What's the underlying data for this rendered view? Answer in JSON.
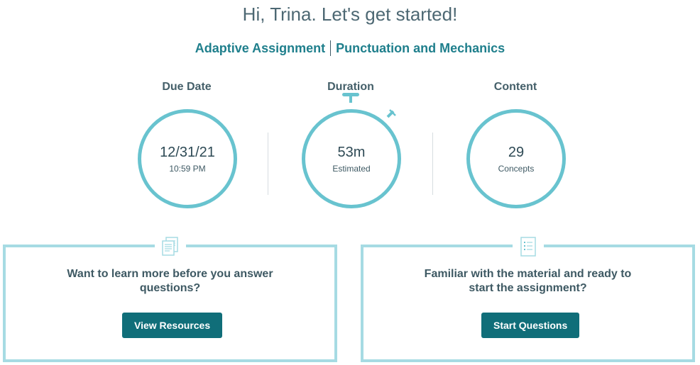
{
  "header": {
    "greeting": "Hi, Trina. Let's get started!",
    "assignment_type": "Adaptive Assignment",
    "assignment_name": "Punctuation and Mechanics"
  },
  "stats": {
    "due": {
      "label": "Due Date",
      "value": "12/31/21",
      "sub": "10:59 PM"
    },
    "duration": {
      "label": "Duration",
      "value": "53m",
      "sub": "Estimated"
    },
    "content": {
      "label": "Content",
      "value": "29",
      "sub": "Concepts"
    }
  },
  "cards": {
    "resources": {
      "line1": "Want to learn more before you answer",
      "line2": "questions?",
      "button": "View Resources",
      "icon": "documents-icon"
    },
    "questions": {
      "line1": "Familiar with the material and ready to",
      "line2": "start the assignment?",
      "button": "Start Questions",
      "icon": "checklist-icon"
    }
  },
  "colors": {
    "accent": "#1f7f8c",
    "ring": "#68c3cf",
    "card_border": "#a6dbe3",
    "button": "#106e79"
  }
}
